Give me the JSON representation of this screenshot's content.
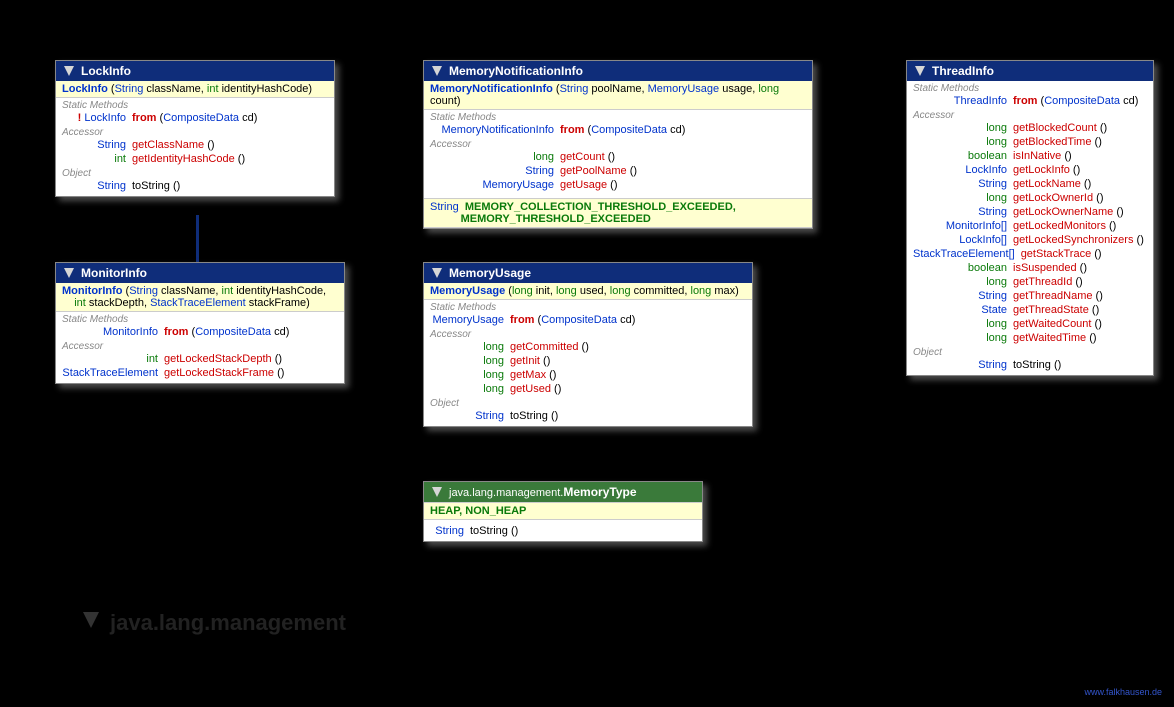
{
  "package": "java.lang.management",
  "footer": "www.falkhausen.de",
  "lockInfo": {
    "title": "LockInfo",
    "ctor": {
      "name": "LockInfo",
      "params": "(String className, int identityHashCode)"
    },
    "sections": {
      "staticMethods": "Static Methods",
      "accessor": "Accessor",
      "object": "Object"
    },
    "from": {
      "bang": "!",
      "ret": "LockInfo",
      "name": "from",
      "params": "(CompositeData cd)"
    },
    "acc": [
      {
        "ret": "String",
        "name": "getClassName",
        "params": "()"
      },
      {
        "ret": "int",
        "name": "getIdentityHashCode",
        "params": "()"
      }
    ],
    "obj": {
      "ret": "String",
      "name": "toString",
      "params": "()"
    }
  },
  "monitorInfo": {
    "title": "MonitorInfo",
    "ctor": {
      "name": "MonitorInfo",
      "params1": "(String className, int identityHashCode,",
      "params2": "int stackDepth, StackTraceElement stackFrame)"
    },
    "sections": {
      "staticMethods": "Static Methods",
      "accessor": "Accessor"
    },
    "from": {
      "ret": "MonitorInfo",
      "name": "from",
      "params": "(CompositeData cd)"
    },
    "acc": [
      {
        "ret": "int",
        "name": "getLockedStackDepth",
        "params": "()"
      },
      {
        "ret": "StackTraceElement",
        "name": "getLockedStackFrame",
        "params": "()"
      }
    ]
  },
  "memNotif": {
    "title": "MemoryNotificationInfo",
    "ctor": {
      "name": "MemoryNotificationInfo",
      "params": "(String poolName, MemoryUsage usage, long count)"
    },
    "sections": {
      "staticMethods": "Static Methods",
      "accessor": "Accessor"
    },
    "from": {
      "ret": "MemoryNotificationInfo",
      "name": "from",
      "params": "(CompositeData cd)"
    },
    "acc": [
      {
        "ret": "long",
        "name": "getCount",
        "params": "()"
      },
      {
        "ret": "String",
        "name": "getPoolName",
        "params": "()"
      },
      {
        "ret": "MemoryUsage",
        "name": "getUsage",
        "params": "()"
      }
    ],
    "constLabel": "String",
    "constants": "MEMORY_COLLECTION_THRESHOLD_EXCEEDED,",
    "constants2": "MEMORY_THRESHOLD_EXCEEDED"
  },
  "memUsage": {
    "title": "MemoryUsage",
    "ctor": {
      "name": "MemoryUsage",
      "params": "(long init, long used, long committed, long max)"
    },
    "sections": {
      "staticMethods": "Static Methods",
      "accessor": "Accessor",
      "object": "Object"
    },
    "from": {
      "ret": "MemoryUsage",
      "name": "from",
      "params": "(CompositeData cd)"
    },
    "acc": [
      {
        "ret": "long",
        "name": "getCommitted",
        "params": "()"
      },
      {
        "ret": "long",
        "name": "getInit",
        "params": "()"
      },
      {
        "ret": "long",
        "name": "getMax",
        "params": "()"
      },
      {
        "ret": "long",
        "name": "getUsed",
        "params": "()"
      }
    ],
    "obj": {
      "ret": "String",
      "name": "toString",
      "params": "()"
    }
  },
  "memType": {
    "pkg": "java.lang.management.",
    "title": "MemoryType",
    "constants": "HEAP, NON_HEAP",
    "obj": {
      "ret": "String",
      "name": "toString",
      "params": "()"
    }
  },
  "threadInfo": {
    "title": "ThreadInfo",
    "sections": {
      "staticMethods": "Static Methods",
      "accessor": "Accessor",
      "object": "Object"
    },
    "from": {
      "ret": "ThreadInfo",
      "name": "from",
      "params": "(CompositeData cd)"
    },
    "acc": [
      {
        "ret": "long",
        "retColor": "green",
        "name": "getBlockedCount",
        "params": "()"
      },
      {
        "ret": "long",
        "retColor": "green",
        "name": "getBlockedTime",
        "params": "()"
      },
      {
        "ret": "boolean",
        "retColor": "green",
        "name": "isInNative",
        "params": "()"
      },
      {
        "ret": "LockInfo",
        "retColor": "blue",
        "name": "getLockInfo",
        "params": "()"
      },
      {
        "ret": "String",
        "retColor": "blue",
        "name": "getLockName",
        "params": "()"
      },
      {
        "ret": "long",
        "retColor": "green",
        "name": "getLockOwnerId",
        "params": "()"
      },
      {
        "ret": "String",
        "retColor": "blue",
        "name": "getLockOwnerName",
        "params": "()"
      },
      {
        "ret": "MonitorInfo[]",
        "retColor": "blue",
        "name": "getLockedMonitors",
        "params": "()"
      },
      {
        "ret": "LockInfo[]",
        "retColor": "blue",
        "name": "getLockedSynchronizers",
        "params": "()"
      },
      {
        "ret": "StackTraceElement[]",
        "retColor": "blue",
        "name": "getStackTrace",
        "params": "()"
      },
      {
        "ret": "boolean",
        "retColor": "green",
        "name": "isSuspended",
        "params": "()"
      },
      {
        "ret": "long",
        "retColor": "green",
        "name": "getThreadId",
        "params": "()"
      },
      {
        "ret": "String",
        "retColor": "blue",
        "name": "getThreadName",
        "params": "()"
      },
      {
        "ret": "State",
        "retColor": "blue",
        "name": "getThreadState",
        "params": "()"
      },
      {
        "ret": "long",
        "retColor": "green",
        "name": "getWaitedCount",
        "params": "()"
      },
      {
        "ret": "long",
        "retColor": "green",
        "name": "getWaitedTime",
        "params": "()"
      }
    ],
    "obj": {
      "ret": "String",
      "name": "toString",
      "params": "()"
    }
  }
}
